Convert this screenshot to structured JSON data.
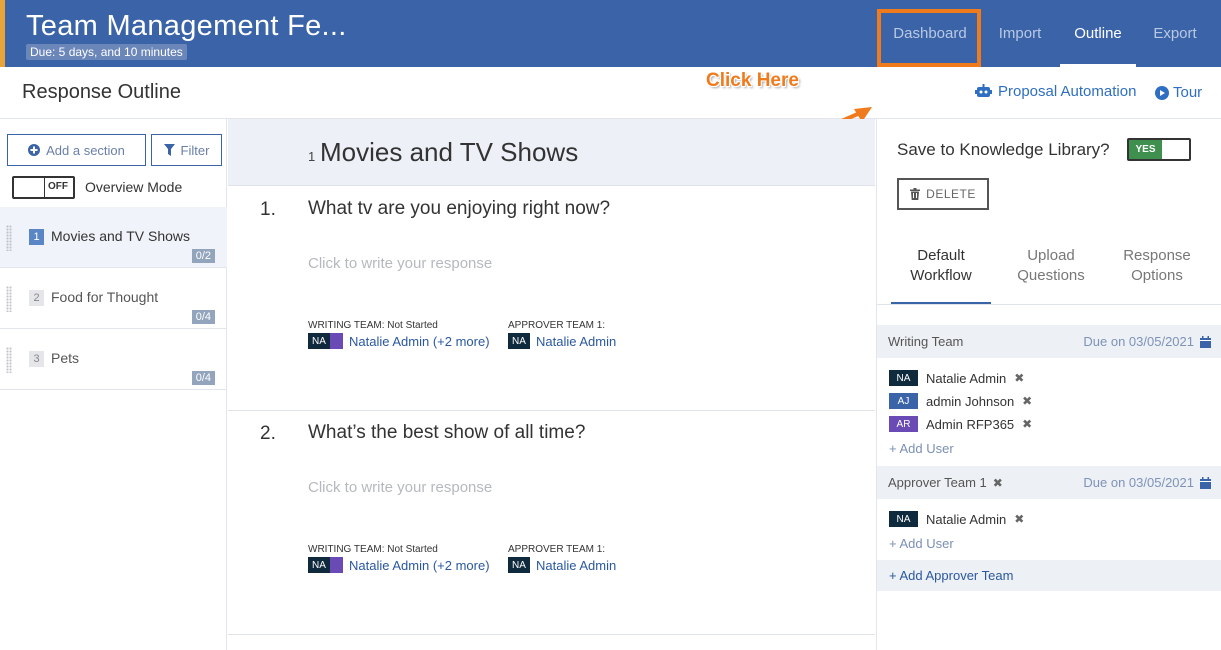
{
  "header": {
    "title": "Team Management Fe...",
    "due": "Due: 5 days, and 10 minutes",
    "nav": [
      {
        "label": "Dashboard"
      },
      {
        "label": "Import"
      },
      {
        "label": "Outline"
      },
      {
        "label": "Export"
      }
    ],
    "active_tab": "Outline"
  },
  "annotation": {
    "text": "Click Here",
    "color": "#f07b1c"
  },
  "subheader": {
    "title": "Response Outline",
    "proposal_automation": "Proposal Automation",
    "tour": "Tour"
  },
  "sidebar": {
    "add_section": "Add a section",
    "filter": "Filter",
    "toggle_state": "OFF",
    "overview_mode": "Overview Mode",
    "sections": [
      {
        "num": "1",
        "label": "Movies and TV Shows",
        "count": "0/2"
      },
      {
        "num": "2",
        "label": "Food for Thought",
        "count": "0/4"
      },
      {
        "num": "3",
        "label": "Pets",
        "count": "0/4"
      }
    ]
  },
  "content": {
    "section_num": "1",
    "section_title": "Movies and TV Shows",
    "questions": [
      {
        "num": "1.",
        "text": "What tv are you enjoying right now?",
        "placeholder": "Click to write your response",
        "writing_team": "WRITING TEAM: Not Started",
        "writing_avatar": "NA",
        "writing_members": "Natalie Admin (+2 more)",
        "approver_team": "APPROVER TEAM 1:",
        "approver_avatar": "NA",
        "approver_member": "Natalie Admin"
      },
      {
        "num": "2.",
        "text": "What’s the best show of all time?",
        "placeholder": "Click to write your response",
        "writing_team": "WRITING TEAM: Not Started",
        "writing_avatar": "NA",
        "writing_members": "Natalie Admin (+2 more)",
        "approver_team": "APPROVER TEAM 1:",
        "approver_avatar": "NA",
        "approver_member": "Natalie Admin"
      }
    ]
  },
  "rpanel": {
    "save_label": "Save to Knowledge Library?",
    "save_toggle": "YES",
    "delete": "DELETE",
    "tabs": [
      {
        "line1": "Default",
        "line2": "Workflow"
      },
      {
        "line1": "Upload",
        "line2": "Questions"
      },
      {
        "line1": "Response",
        "line2": "Options"
      }
    ],
    "writing_team": {
      "label": "Writing Team",
      "due": "Due on 03/05/2021",
      "members": [
        {
          "initials": "NA",
          "name": "Natalie Admin",
          "color": "#0f2a3d"
        },
        {
          "initials": "AJ",
          "name": "admin Johnson",
          "color": "#3b64a8"
        },
        {
          "initials": "AR",
          "name": "Admin RFP365",
          "color": "#6a4bb5"
        }
      ],
      "add_user": "+ Add User"
    },
    "approver_team": {
      "label": "Approver Team 1",
      "due": "Due on 03/05/2021",
      "members": [
        {
          "initials": "NA",
          "name": "Natalie Admin",
          "color": "#0f2a3d"
        }
      ],
      "add_user": "+ Add User"
    },
    "add_approver_team": "+ Add Approver Team"
  }
}
